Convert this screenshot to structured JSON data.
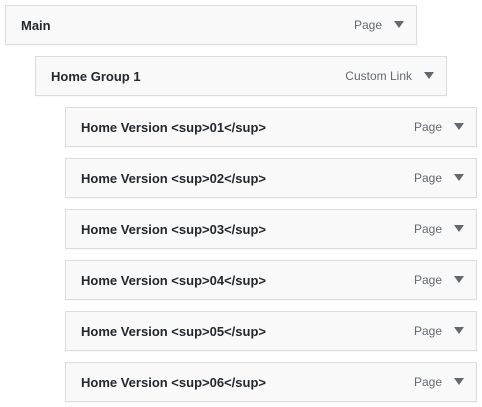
{
  "menu_items": [
    {
      "title": "Main",
      "type": "Page",
      "toggle_icon": "arrow-down-icon"
    },
    {
      "title": "Home Group 1",
      "type": "Custom Link",
      "toggle_icon": "arrow-down-icon"
    },
    {
      "title": "Home Version <sup>01</sup>",
      "type": "Page",
      "toggle_icon": "arrow-down-icon"
    },
    {
      "title": "Home Version <sup>02</sup>",
      "type": "Page",
      "toggle_icon": "arrow-down-icon"
    },
    {
      "title": "Home Version <sup>03</sup>",
      "type": "Page",
      "toggle_icon": "arrow-down-icon"
    },
    {
      "title": "Home Version <sup>04</sup>",
      "type": "Page",
      "toggle_icon": "arrow-down-icon"
    },
    {
      "title": "Home Version <sup>05</sup>",
      "type": "Page",
      "toggle_icon": "arrow-down-icon"
    },
    {
      "title": "Home Version <sup>06</sup>",
      "type": "Page",
      "toggle_icon": "arrow-down-icon"
    }
  ]
}
